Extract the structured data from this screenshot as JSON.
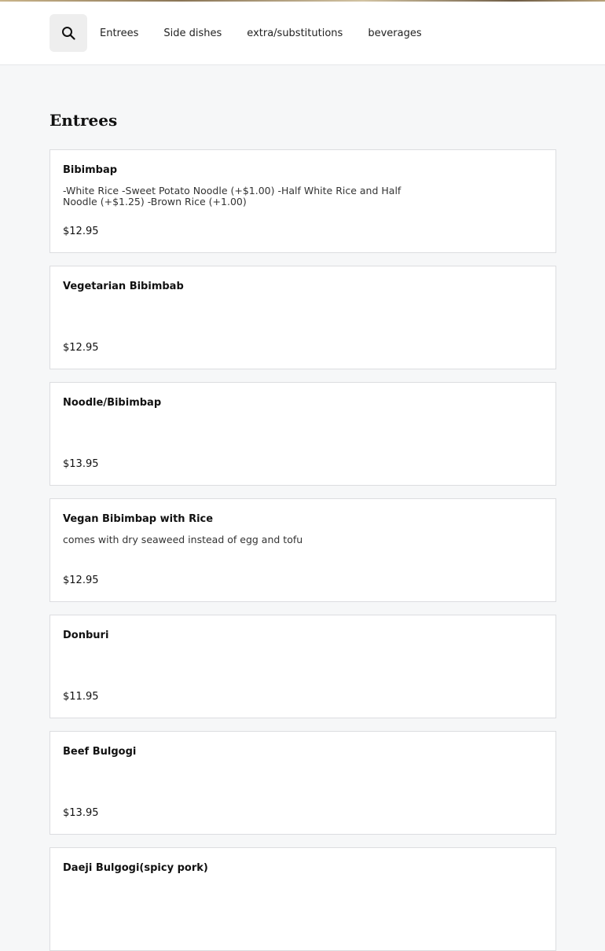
{
  "nav": {
    "search_icon": "search-icon",
    "items": [
      {
        "label": "Entrees"
      },
      {
        "label": "Side dishes"
      },
      {
        "label": "extra/substitutions"
      },
      {
        "label": "beverages"
      }
    ]
  },
  "section": {
    "title": "Entrees"
  },
  "items": [
    {
      "name": "Bibimbap",
      "description": "-White Rice -Sweet Potato Noodle (+$1.00) -Half White Rice and Half Noodle (+$1.25) -Brown Rice (+1.00)",
      "price": "$12.95"
    },
    {
      "name": "Vegetarian Bibimbab",
      "description": "",
      "price": "$12.95"
    },
    {
      "name": "Noodle/Bibimbap",
      "description": "",
      "price": "$13.95"
    },
    {
      "name": "Vegan Bibimbap with Rice",
      "description": "comes with dry seaweed instead of egg and tofu",
      "price": "$12.95"
    },
    {
      "name": "Donburi",
      "description": "",
      "price": "$11.95"
    },
    {
      "name": "Beef Bulgogi",
      "description": "",
      "price": "$13.95"
    },
    {
      "name": "Daeji Bulgogi(spicy pork)",
      "description": "",
      "price": ""
    }
  ]
}
